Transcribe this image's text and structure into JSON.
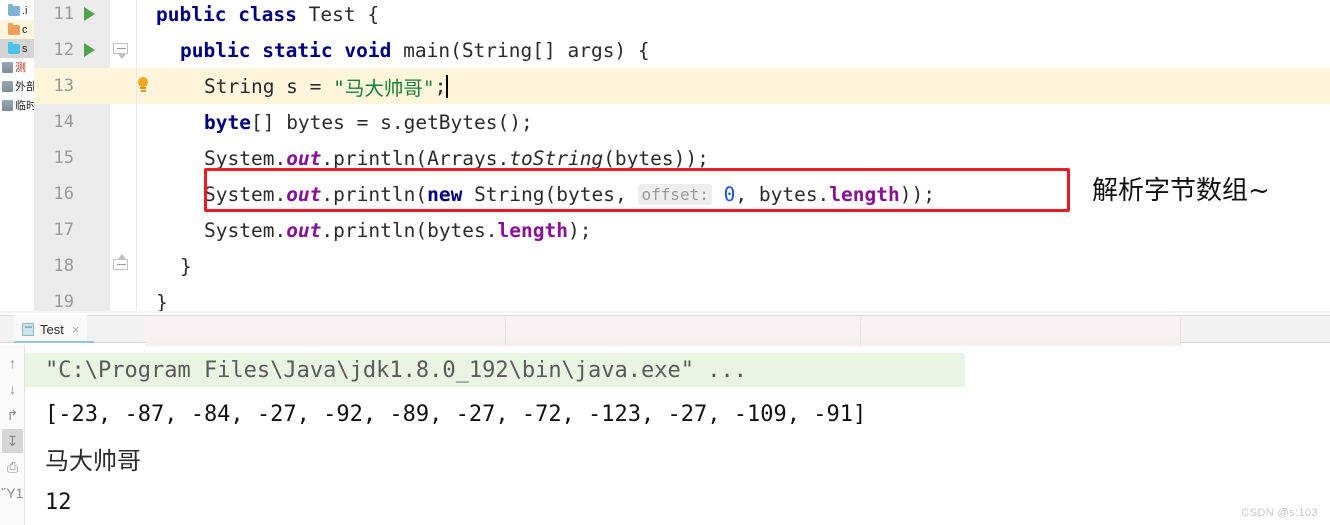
{
  "project_tree": {
    "items": [
      {
        "label": ".i",
        "icon": "folder-icon",
        "color": "f-blue",
        "state": "normal"
      },
      {
        "label": "c",
        "icon": "folder-icon",
        "color": "f-orange",
        "state": "highlight"
      },
      {
        "label": "s",
        "icon": "folder-icon",
        "color": "f-cyan",
        "state": "selected"
      },
      {
        "label": "测",
        "icon": "library-icon",
        "color": "f-gray",
        "state": "normal"
      },
      {
        "label": "外部",
        "icon": "library-icon",
        "color": "f-gray",
        "state": "normal"
      },
      {
        "label": "临时",
        "icon": "library-icon",
        "color": "f-gray",
        "state": "normal"
      }
    ]
  },
  "editor": {
    "lines": [
      {
        "number": "11",
        "run_marker": true,
        "fold": null,
        "bulb": false,
        "highlight": false,
        "indent": 0,
        "tokens": [
          {
            "t": "public",
            "c": "kw"
          },
          {
            "t": " ",
            "c": "plain"
          },
          {
            "t": "class",
            "c": "kw"
          },
          {
            "t": " Test {",
            "c": "plain"
          }
        ]
      },
      {
        "number": "12",
        "run_marker": true,
        "fold": "down",
        "bulb": false,
        "highlight": false,
        "indent": 1,
        "tokens": [
          {
            "t": "public",
            "c": "kw"
          },
          {
            "t": " ",
            "c": "plain"
          },
          {
            "t": "static",
            "c": "kw"
          },
          {
            "t": " ",
            "c": "plain"
          },
          {
            "t": "void",
            "c": "kw"
          },
          {
            "t": " main(String[] args) {",
            "c": "plain"
          }
        ]
      },
      {
        "number": "13",
        "run_marker": false,
        "fold": null,
        "bulb": true,
        "highlight": true,
        "indent": 2,
        "caret": true,
        "tokens": [
          {
            "t": "String s = ",
            "c": "plain"
          },
          {
            "t": "\"马大帅哥\"",
            "c": "str"
          },
          {
            "t": ";",
            "c": "plain"
          }
        ]
      },
      {
        "number": "14",
        "run_marker": false,
        "fold": null,
        "bulb": false,
        "highlight": false,
        "indent": 2,
        "tokens": [
          {
            "t": "byte",
            "c": "kw"
          },
          {
            "t": "[] bytes = s.getBytes();",
            "c": "plain"
          }
        ]
      },
      {
        "number": "15",
        "run_marker": false,
        "fold": null,
        "bulb": false,
        "highlight": false,
        "indent": 2,
        "tokens": [
          {
            "t": "System.",
            "c": "plain"
          },
          {
            "t": "out",
            "c": "stat"
          },
          {
            "t": ".println(Arrays.",
            "c": "plain"
          },
          {
            "t": "toString",
            "c": "statit"
          },
          {
            "t": "(bytes));",
            "c": "plain"
          }
        ]
      },
      {
        "number": "16",
        "run_marker": false,
        "fold": null,
        "bulb": false,
        "highlight": false,
        "indent": 2,
        "tokens": [
          {
            "t": "System.",
            "c": "plain"
          },
          {
            "t": "out",
            "c": "stat"
          },
          {
            "t": ".println(",
            "c": "plain"
          },
          {
            "t": "new",
            "c": "kw"
          },
          {
            "t": " String(bytes, ",
            "c": "plain"
          },
          {
            "t": "offset:",
            "c": "hint"
          },
          {
            "t": " ",
            "c": "plain"
          },
          {
            "t": "0",
            "c": "num"
          },
          {
            "t": ", bytes.",
            "c": "plain"
          },
          {
            "t": "length",
            "c": "fld"
          },
          {
            "t": "));",
            "c": "plain"
          }
        ]
      },
      {
        "number": "17",
        "run_marker": false,
        "fold": null,
        "bulb": false,
        "highlight": false,
        "indent": 2,
        "tokens": [
          {
            "t": "System.",
            "c": "plain"
          },
          {
            "t": "out",
            "c": "stat"
          },
          {
            "t": ".println(bytes.",
            "c": "plain"
          },
          {
            "t": "length",
            "c": "fld"
          },
          {
            "t": ");",
            "c": "plain"
          }
        ]
      },
      {
        "number": "18",
        "run_marker": false,
        "fold": "up",
        "bulb": false,
        "highlight": false,
        "indent": 1,
        "tokens": [
          {
            "t": "}",
            "c": "plain"
          }
        ]
      },
      {
        "number": "19",
        "run_marker": false,
        "fold": null,
        "bulb": false,
        "highlight": false,
        "indent": 0,
        "tokens": [
          {
            "t": "}",
            "c": "plain"
          }
        ]
      }
    ],
    "annotation": "解析字节数组~",
    "highlight_box_color": "#ec1c24"
  },
  "console": {
    "tab": {
      "label": "Test",
      "close": "×",
      "icon": "run-config-icon"
    },
    "toolbar": [
      {
        "name": "scroll-up-button",
        "glyph": "↑",
        "active": false
      },
      {
        "name": "scroll-down-button",
        "glyph": "↓",
        "active": false
      },
      {
        "name": "soft-wrap-button",
        "glyph": "↱",
        "active": false
      },
      {
        "name": "scroll-to-end-button",
        "glyph": "↧",
        "active": true
      },
      {
        "name": "print-button",
        "glyph": "⎙",
        "active": false
      },
      {
        "name": "clear-all-button",
        "glyph": "Ὕ1",
        "active": false
      }
    ],
    "output": [
      {
        "text": "\"C:\\Program Files\\Java\\jdk1.8.0_192\\bin\\java.exe\" ...",
        "kind": "cmd"
      },
      {
        "text": "[-23, -87, -84, -27, -92, -89, -27, -72, -123, -27, -109, -91]",
        "kind": "plainout"
      },
      {
        "text": "马大帅哥",
        "kind": "cjk"
      },
      {
        "text": "12",
        "kind": "plainout"
      }
    ]
  },
  "watermark": "CSDN @s:103"
}
